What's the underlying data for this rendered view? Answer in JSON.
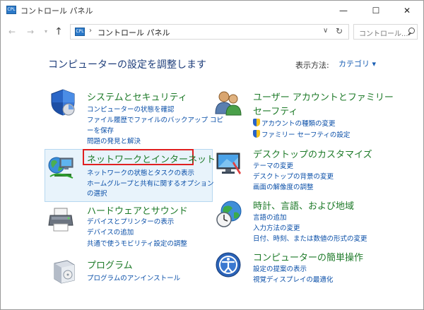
{
  "window": {
    "title": "コントロール パネル",
    "app_icon_glyph": "CPL",
    "buttons": {
      "minimize": "—",
      "maximize": "☐",
      "close": "✕"
    }
  },
  "nav": {
    "back": "←",
    "forward": "→",
    "recent": "▾",
    "up": "↑"
  },
  "address": {
    "separator": "›",
    "path": "コントロール パネル",
    "dropdown": "∨",
    "refresh": "↻"
  },
  "search": {
    "placeholder": "コントロール..."
  },
  "heading": "コンピューターの設定を調整します",
  "view_by": {
    "label": "表示方法:",
    "value": "カテゴリ ▾"
  },
  "categories": {
    "system": {
      "title": "システムとセキュリティ",
      "links": [
        "コンピューターの状態を確認",
        "ファイル履歴でファイルのバックアップ コピ",
        "ーを保存",
        "問題の発見と解決"
      ]
    },
    "network": {
      "title": "ネットワークとインターネット",
      "links": [
        "ネットワークの状態とタスクの表示",
        "ホームグループと共有に関するオプション",
        "の選択"
      ]
    },
    "hardware": {
      "title": "ハードウェアとサウンド",
      "links": [
        "デバイスとプリンターの表示",
        "デバイスの追加",
        "共通で使うモビリティ設定の調整"
      ]
    },
    "programs": {
      "title": "プログラム",
      "links": [
        "プログラムのアンインストール"
      ]
    },
    "users": {
      "title_line1": "ユーザー アカウントとファミリー",
      "title_line2": "セーフティ",
      "links": [
        "アカウントの種類の変更",
        "ファミリー セーフティの設定"
      ]
    },
    "desktop": {
      "title": "デスクトップのカスタマイズ",
      "links": [
        "テーマの変更",
        "デスクトップの背景の変更",
        "画面の解像度の調整"
      ]
    },
    "clock": {
      "title": "時計、言語、および地域",
      "links": [
        "言語の追加",
        "入力方法の変更",
        "日付、時刻、または数値の形式の変更"
      ]
    },
    "ease": {
      "title": "コンピューターの簡単操作",
      "links": [
        "設定の提案の表示",
        "視覚ディスプレイの最適化"
      ]
    }
  }
}
